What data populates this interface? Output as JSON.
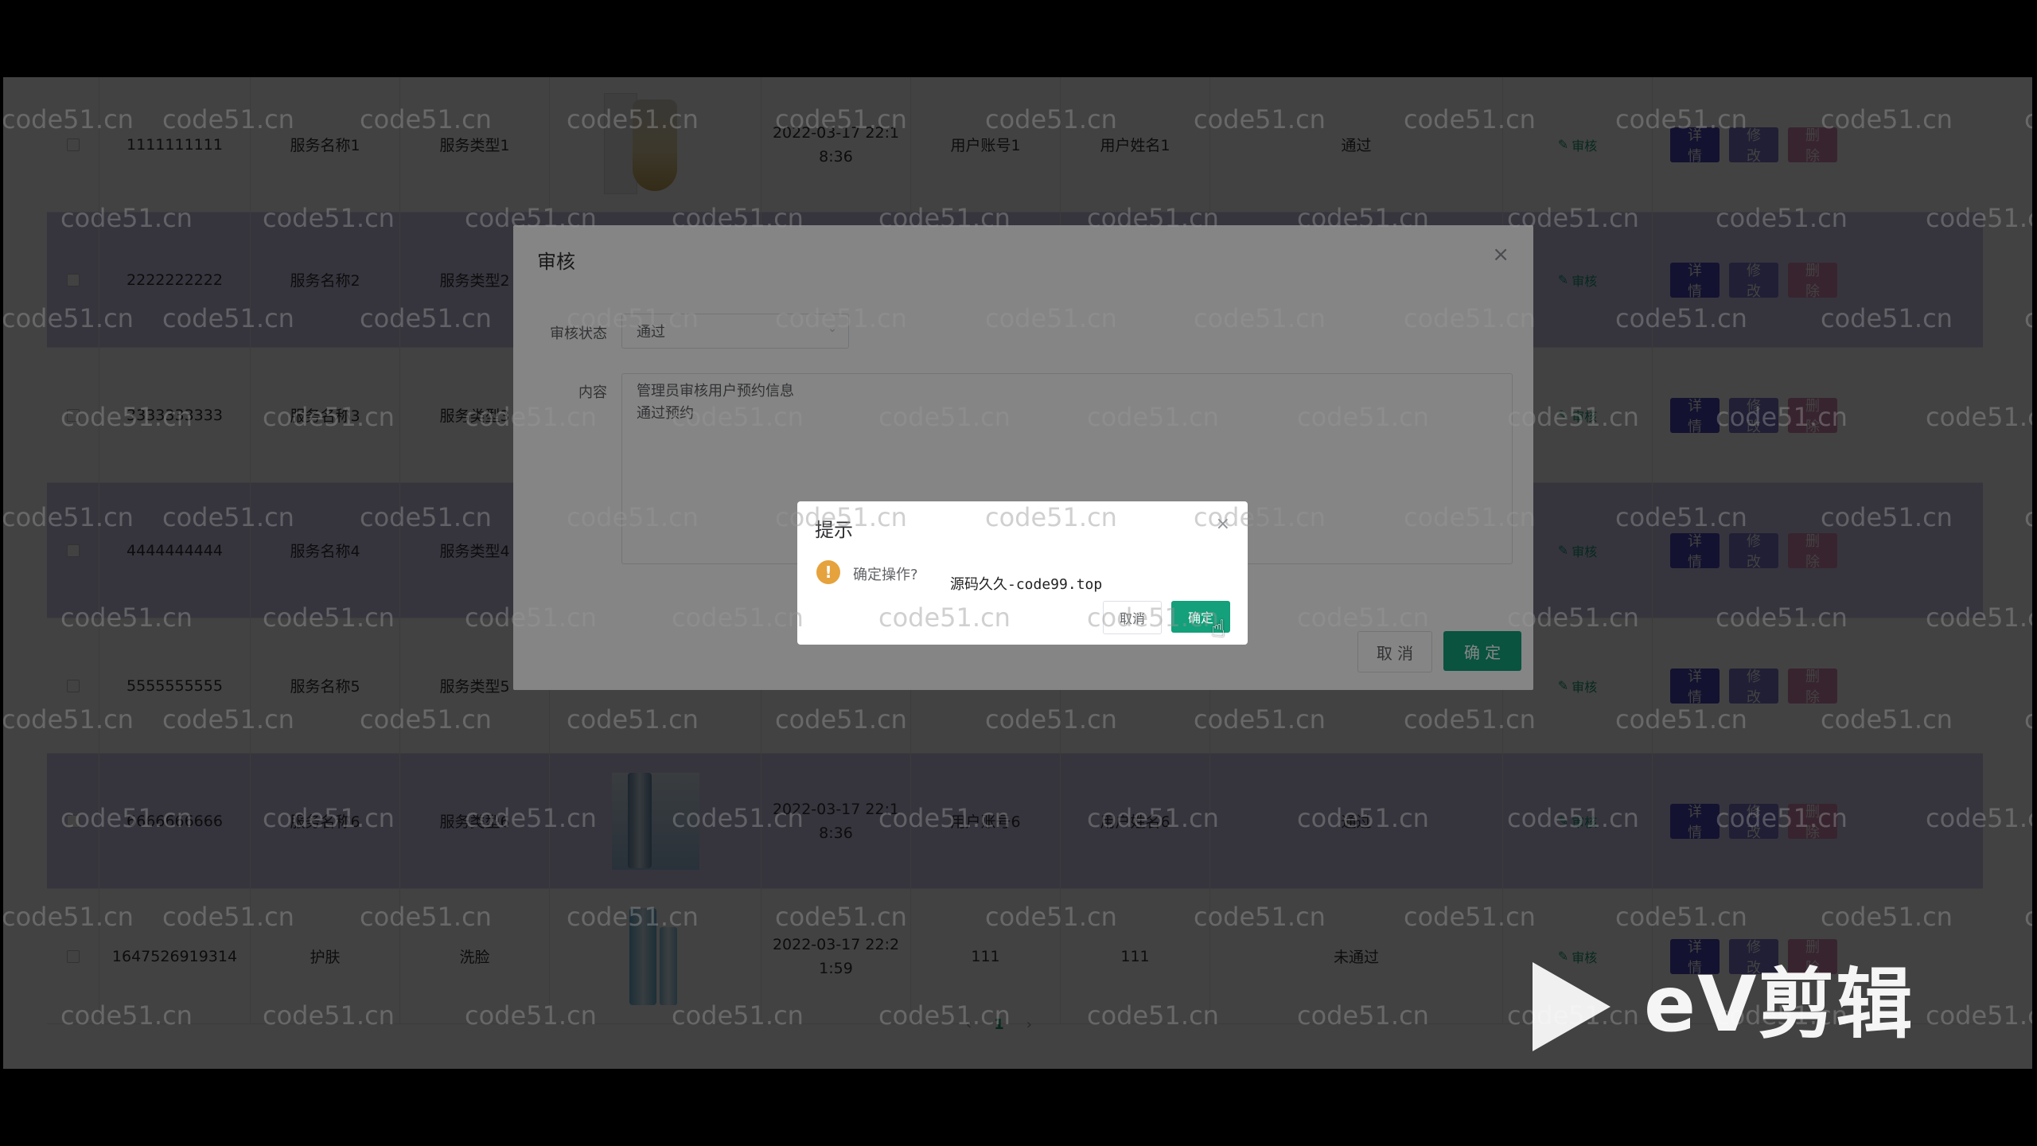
{
  "rows": [
    {
      "id": "1111111111",
      "name": "服务名称1",
      "type": "服务类型1",
      "time": "2022-03-17 22:1 8:36",
      "account": "用户账号1",
      "user": "用户姓名1",
      "status": "通过",
      "audit": "审核",
      "alt": false,
      "img": "perfume"
    },
    {
      "id": "2222222222",
      "name": "服务名称2",
      "type": "服务类型2",
      "time": "",
      "account": "",
      "user": "",
      "status": "",
      "audit": "审核",
      "alt": true,
      "img": "partial"
    },
    {
      "id": "3333333333",
      "name": "服务名称3",
      "type": "服务类型3",
      "time": "",
      "account": "",
      "user": "",
      "status": "",
      "audit": "审核",
      "alt": false,
      "img": ""
    },
    {
      "id": "4444444444",
      "name": "服务名称4",
      "type": "服务类型4",
      "time": "",
      "account": "",
      "user": "",
      "status": "",
      "audit": "审核",
      "alt": true,
      "img": ""
    },
    {
      "id": "5555555555",
      "name": "服务名称5",
      "type": "服务类型5",
      "time": "",
      "account": "",
      "user": "",
      "status": "",
      "audit": "审核",
      "alt": false,
      "img": ""
    },
    {
      "id": "6666666666",
      "name": "服务名称6",
      "type": "服务类型6",
      "time": "2022-03-17 22:1 8:36",
      "account": "用户账号6",
      "user": "用户姓名6",
      "status": "通过",
      "audit": "审核",
      "alt": true,
      "img": "serum"
    },
    {
      "id": "1647526919314",
      "name": "护肤",
      "type": "洗脸",
      "time": "2022-03-17 22:2 1:59",
      "account": "111",
      "user": "111",
      "status": "未通过",
      "audit": "审核",
      "alt": false,
      "img": "toner"
    }
  ],
  "row_buttons": {
    "detail": "详情",
    "edit": "修改",
    "delete": "删除"
  },
  "pagination": {
    "prev": "‹",
    "current": "1",
    "next": "›"
  },
  "dialog": {
    "title": "审核",
    "status_label": "审核状态",
    "status_value": "通过",
    "content_label": "内容",
    "content_value": "管理员审核用户预约信息\n通过预约",
    "cancel": "取 消",
    "confirm": "确 定"
  },
  "messagebox": {
    "title": "提示",
    "text": "确定操作?",
    "extra": "源码久久-code99.top",
    "cancel": "取消",
    "confirm": "确定"
  },
  "watermark": "code51.cn",
  "logo": "eV剪辑"
}
